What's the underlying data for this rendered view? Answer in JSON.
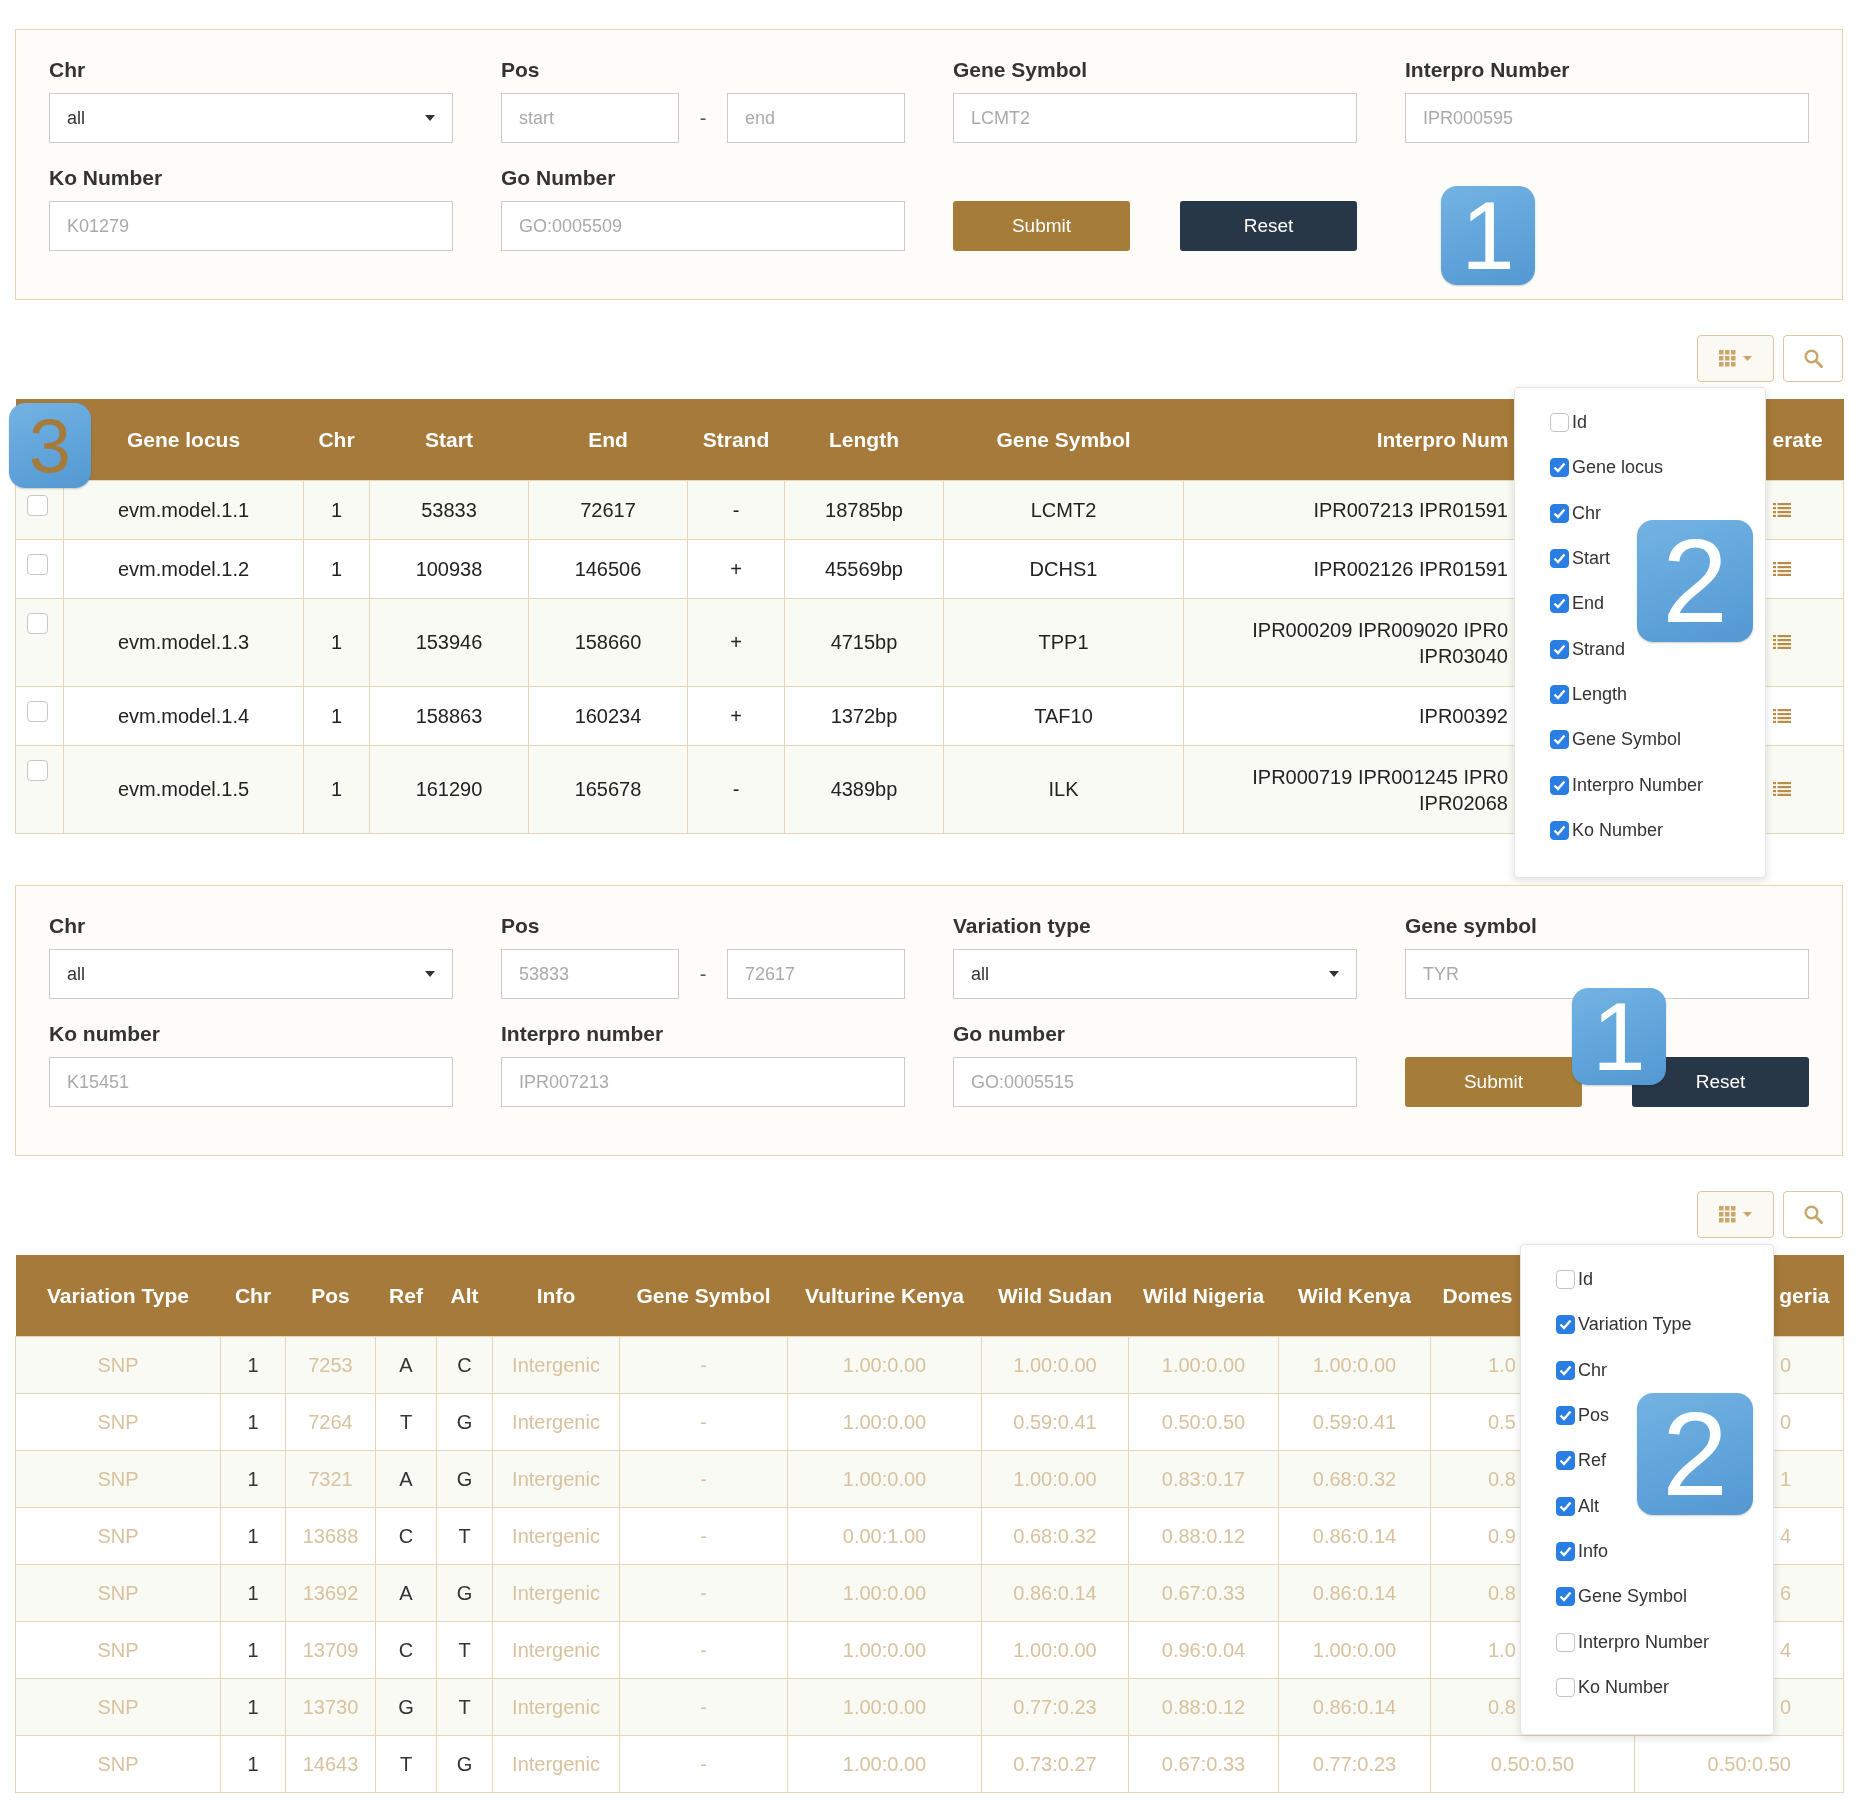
{
  "gene_search_form": {
    "items": [
      {
        "kind": "select",
        "label": "Chr",
        "value": "all"
      },
      {
        "kind": "range",
        "label": "Pos",
        "start_placeholder": "start",
        "separator": "-",
        "end_placeholder": "end"
      },
      {
        "kind": "text",
        "label": "Gene Symbol",
        "placeholder": "LCMT2"
      },
      {
        "kind": "text",
        "label": "Interpro Number",
        "placeholder": "IPR000595"
      },
      {
        "kind": "text",
        "label": "Ko Number",
        "placeholder": "K01279"
      },
      {
        "kind": "text",
        "label": "Go Number",
        "placeholder": "GO:0005509"
      },
      {
        "kind": "buttons",
        "buttons": [
          {
            "label": "Submit"
          },
          {
            "label": "Reset"
          }
        ]
      }
    ],
    "badges": [
      {
        "text": "1",
        "color": "#ffffff"
      }
    ]
  },
  "gene_table": {
    "columns": [
      "Gene locus",
      "Chr",
      "Start",
      "End",
      "Strand",
      "Length",
      "Gene Symbol",
      "Interpro Num",
      "erate"
    ],
    "rows": [
      {
        "checked": false,
        "cells": [
          "evm.model.1.1",
          "1",
          "53833",
          "72617",
          "-",
          "18785bp",
          "LCMT2",
          "IPR007213 IPR01591"
        ]
      },
      {
        "checked": false,
        "cells": [
          "evm.model.1.2",
          "1",
          "100938",
          "146506",
          "+",
          "45569bp",
          "DCHS1",
          "IPR002126 IPR01591"
        ]
      },
      {
        "checked": false,
        "cells": [
          "evm.model.1.3",
          "1",
          "153946",
          "158660",
          "+",
          "4715bp",
          "TPP1",
          "IPR000209 IPR009020 IPR0\nIPR03040"
        ]
      },
      {
        "checked": false,
        "cells": [
          "evm.model.1.4",
          "1",
          "158863",
          "160234",
          "+",
          "1372bp",
          "TAF10",
          "IPR00392"
        ]
      },
      {
        "checked": false,
        "cells": [
          "evm.model.1.5",
          "1",
          "161290",
          "165678",
          "-",
          "4389bp",
          "ILK",
          "IPR000719 IPR001245 IPR0\nIPR02068"
        ]
      }
    ],
    "columns_menu": {
      "items": [
        {
          "label": "Id",
          "checked": false
        },
        {
          "label": "Gene locus",
          "checked": true
        },
        {
          "label": "Chr",
          "checked": true
        },
        {
          "label": "Start",
          "checked": true
        },
        {
          "label": "End",
          "checked": true
        },
        {
          "label": "Strand",
          "checked": true
        },
        {
          "label": "Length",
          "checked": true
        },
        {
          "label": "Gene Symbol",
          "checked": true
        },
        {
          "label": "Interpro Number",
          "checked": true
        },
        {
          "label": "Ko Number",
          "checked": true
        }
      ]
    },
    "badges": [
      {
        "text": "2",
        "color": "#ffffff"
      },
      {
        "text": "3",
        "color": "#a57a3a"
      }
    ]
  },
  "variation_search_form": {
    "items": [
      {
        "kind": "select",
        "label": "Chr",
        "value": "all"
      },
      {
        "kind": "range",
        "label": "Pos",
        "start_placeholder": "53833",
        "separator": "-",
        "end_placeholder": "72617"
      },
      {
        "kind": "select",
        "label": "Variation type",
        "value": "all"
      },
      {
        "kind": "text",
        "label": "Gene symbol",
        "placeholder": "TYR"
      },
      {
        "kind": "text",
        "label": "Ko number",
        "placeholder": "K15451"
      },
      {
        "kind": "text",
        "label": "Interpro number",
        "placeholder": "IPR007213"
      },
      {
        "kind": "text",
        "label": "Go number",
        "placeholder": "GO:0005515"
      },
      {
        "kind": "buttons",
        "buttons": [
          {
            "label": "Submit"
          },
          {
            "label": "Reset"
          }
        ]
      }
    ],
    "badges": [
      {
        "text": "1",
        "color": "#ffffff"
      }
    ]
  },
  "variation_table": {
    "columns": [
      {
        "label": "Variation Type",
        "muted": true
      },
      {
        "label": "Chr",
        "muted": false
      },
      {
        "label": "Pos",
        "muted": true
      },
      {
        "label": "Ref",
        "muted": false
      },
      {
        "label": "Alt",
        "muted": false
      },
      {
        "label": "Info",
        "muted": true
      },
      {
        "label": "Gene Symbol",
        "muted": true
      },
      {
        "label": "Vulturine Kenya",
        "muted": true
      },
      {
        "label": "Wild Sudan",
        "muted": true
      },
      {
        "label": "Wild Nigeria",
        "muted": true
      },
      {
        "label": "Wild Kenya",
        "muted": true
      },
      {
        "label": "Domes",
        "muted": true
      },
      {
        "label": "geria",
        "muted": true
      }
    ],
    "rows": [
      [
        "SNP",
        "1",
        "7253",
        "A",
        "C",
        "Intergenic",
        "-",
        "1.00:0.00",
        "1.00:0.00",
        "1.00:0.00",
        "1.00:0.00",
        "1.0",
        "0"
      ],
      [
        "SNP",
        "1",
        "7264",
        "T",
        "G",
        "Intergenic",
        "-",
        "1.00:0.00",
        "0.59:0.41",
        "0.50:0.50",
        "0.59:0.41",
        "0.5",
        "0"
      ],
      [
        "SNP",
        "1",
        "7321",
        "A",
        "G",
        "Intergenic",
        "-",
        "1.00:0.00",
        "1.00:0.00",
        "0.83:0.17",
        "0.68:0.32",
        "0.8",
        "1"
      ],
      [
        "SNP",
        "1",
        "13688",
        "C",
        "T",
        "Intergenic",
        "-",
        "0.00:1.00",
        "0.68:0.32",
        "0.88:0.12",
        "0.86:0.14",
        "0.9",
        "4"
      ],
      [
        "SNP",
        "1",
        "13692",
        "A",
        "G",
        "Intergenic",
        "-",
        "1.00:0.00",
        "0.86:0.14",
        "0.67:0.33",
        "0.86:0.14",
        "0.8",
        "6"
      ],
      [
        "SNP",
        "1",
        "13709",
        "C",
        "T",
        "Intergenic",
        "-",
        "1.00:0.00",
        "1.00:0.00",
        "0.96:0.04",
        "1.00:0.00",
        "1.0",
        "4"
      ],
      [
        "SNP",
        "1",
        "13730",
        "G",
        "T",
        "Intergenic",
        "-",
        "1.00:0.00",
        "0.77:0.23",
        "0.88:0.12",
        "0.86:0.14",
        "0.8",
        "0"
      ],
      [
        "SNP",
        "1",
        "14643",
        "T",
        "G",
        "Intergenic",
        "-",
        "1.00:0.00",
        "0.73:0.27",
        "0.67:0.33",
        "0.77:0.23",
        "0.50:0.50",
        "0.50:0.50"
      ]
    ],
    "columns_menu": {
      "items": [
        {
          "label": "Id",
          "checked": false
        },
        {
          "label": "Variation Type",
          "checked": true
        },
        {
          "label": "Chr",
          "checked": true
        },
        {
          "label": "Pos",
          "checked": true
        },
        {
          "label": "Ref",
          "checked": true
        },
        {
          "label": "Alt",
          "checked": true
        },
        {
          "label": "Info",
          "checked": true
        },
        {
          "label": "Gene Symbol",
          "checked": true
        },
        {
          "label": "Interpro Number",
          "checked": false
        },
        {
          "label": "Ko Number",
          "checked": false
        }
      ]
    },
    "badges": [
      {
        "text": "2",
        "color": "#ffffff"
      }
    ]
  }
}
